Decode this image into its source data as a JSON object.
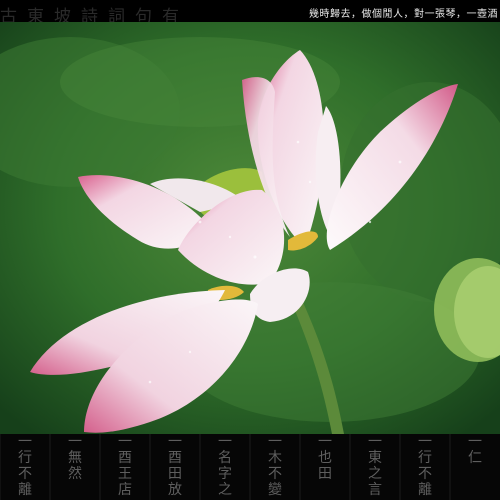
{
  "header": {
    "caption": "幾時歸去，做個閒人，對一張琴，一壺酒",
    "background_script": "古東坡詩詞句有"
  },
  "footer": {
    "calligraphy_columns": [
      "一行不離",
      "一無然",
      "一酉王店",
      "一酉田放",
      "一名字之",
      "一木不變",
      "一也田",
      "一東之言",
      "一行不離",
      "一仁"
    ]
  },
  "colors": {
    "background": "#000000",
    "leaf_green": "#2f6e2a",
    "petal_white": "#f6eef2",
    "petal_pink": "#d9628f",
    "stem_green": "#5c8a3a"
  }
}
